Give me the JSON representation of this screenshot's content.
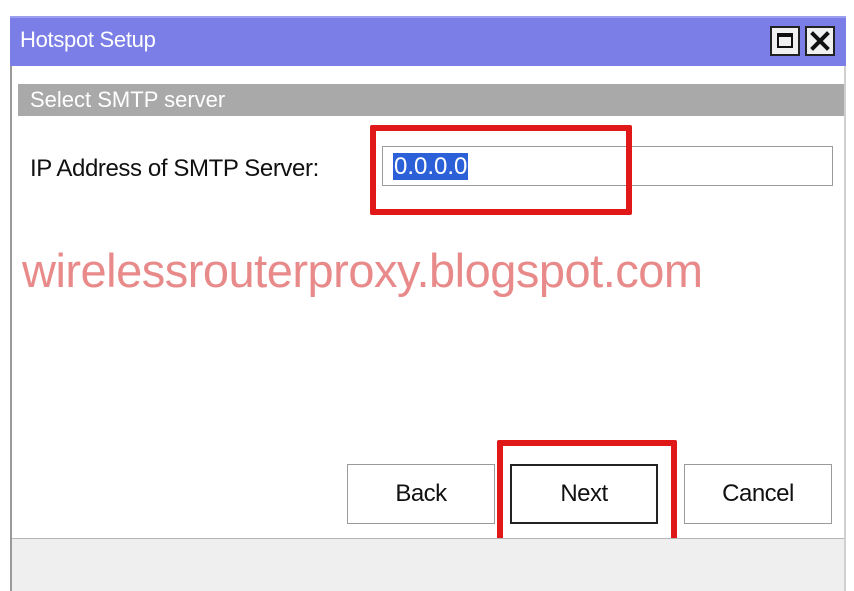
{
  "window": {
    "title": "Hotspot Setup",
    "controls": {
      "maximize_icon": "maximize-icon",
      "close_icon": "close-icon"
    }
  },
  "section": {
    "title": "Select SMTP server"
  },
  "form": {
    "ip_label": "IP Address of SMTP Server:",
    "ip_value": "0.0.0.0"
  },
  "watermark": "wirelessrouterproxy.blogspot.com",
  "buttons": {
    "back": "Back",
    "next": "Next",
    "cancel": "Cancel"
  },
  "colors": {
    "titlebar": "#7a7ee6",
    "highlight": "#e01818",
    "selection": "#2b60d8",
    "watermark": "#e98a8a"
  }
}
